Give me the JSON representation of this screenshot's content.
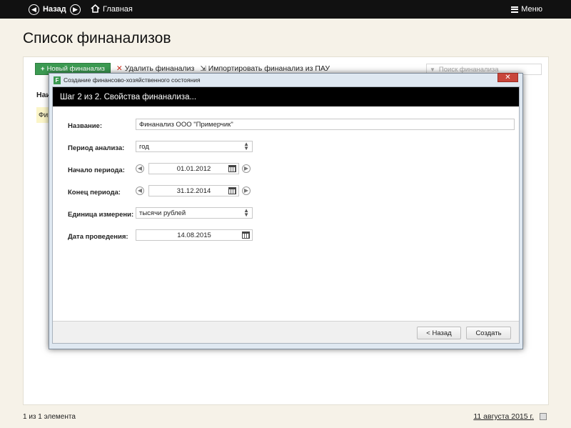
{
  "topbar": {
    "back_label": "Назад",
    "back_icon": "arrow-left-circle-icon",
    "forward_icon": "arrow-right-circle-icon",
    "home_label": "Главная",
    "home_icon": "home-icon",
    "menu_label": "Меню",
    "menu_icon": "hamburger-icon"
  },
  "page": {
    "title": "Список финанализов"
  },
  "toolbar": {
    "new_label": "Новый финанализ",
    "delete_label": "Удалить финанализ",
    "import_label": "Импортировать финанализ из ПАУ",
    "search_placeholder": "Поиск финанализа"
  },
  "table": {
    "header_partial": "Наи",
    "row_partial": "Фин"
  },
  "footer": {
    "count_text": "1 из 1 элемента",
    "date_text": "11 августа 2015 г."
  },
  "dialog": {
    "window_title": "Создание финансово-хозяйственного состояния",
    "app_icon_letter": "F",
    "close_glyph": "✕",
    "step_title": "Шаг 2 из 2.   Свойства финанализа...",
    "fields": {
      "name_label": "Название:",
      "name_value": "Финанализ ООО \"Примерчик\"",
      "period_label": "Период анализа:",
      "period_value": "год",
      "start_label": "Начало периода:",
      "start_value": "01.01.2012",
      "end_label": "Конец периода:",
      "end_value": "31.12.2014",
      "unit_label": "Единица измерени:",
      "unit_value": "тысячи рублей",
      "date_label": "Дата проведения:",
      "date_value": "14.08.2015"
    },
    "back_button": "< Назад",
    "create_button": "Создать"
  },
  "colors": {
    "topbar": "#111111",
    "accent_green": "#3c9a52",
    "close_red": "#c9463b",
    "page_bg": "#f6f2e8"
  }
}
